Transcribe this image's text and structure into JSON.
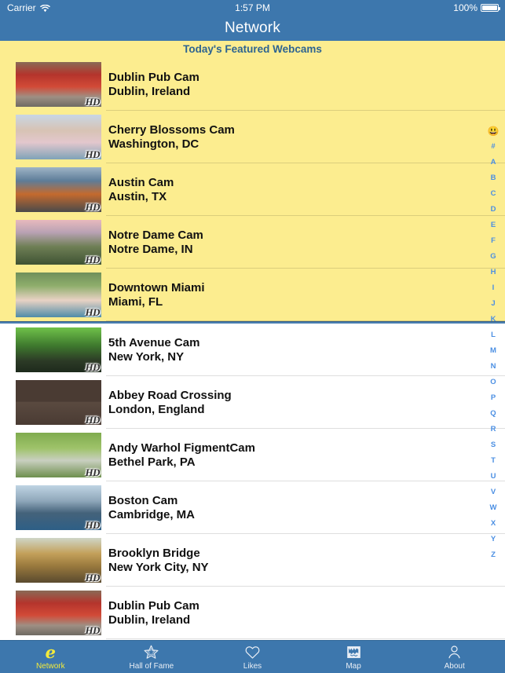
{
  "status_bar": {
    "carrier": "Carrier",
    "wifi_icon": "wifi-icon",
    "time": "1:57 PM",
    "battery_percent": "100%",
    "battery_icon": "battery-full-icon"
  },
  "nav": {
    "title": "Network"
  },
  "featured": {
    "header": "Today's Featured Webcams",
    "items": [
      {
        "name": "Dublin Pub Cam",
        "location": "Dublin, Ireland",
        "badge": "HD"
      },
      {
        "name": "Cherry Blossoms Cam",
        "location": "Washington, DC",
        "badge": "HD"
      },
      {
        "name": "Austin Cam",
        "location": "Austin, TX",
        "badge": "HD"
      },
      {
        "name": "Notre Dame Cam",
        "location": "Notre Dame, IN",
        "badge": "HD"
      },
      {
        "name": "Downtown Miami",
        "location": "Miami, FL",
        "badge": "HD"
      }
    ]
  },
  "main_list": {
    "items": [
      {
        "name": "5th Avenue Cam",
        "location": "New York, NY",
        "badge": "HD"
      },
      {
        "name": "Abbey Road Crossing",
        "location": "London, England",
        "badge": "HD"
      },
      {
        "name": "Andy Warhol FigmentCam",
        "location": "Bethel Park, PA",
        "badge": "HD"
      },
      {
        "name": "Boston Cam",
        "location": "Cambridge, MA",
        "badge": "HD"
      },
      {
        "name": "Brooklyn Bridge",
        "location": "New York City, NY",
        "badge": "HD"
      },
      {
        "name": "Dublin Pub Cam",
        "location": "Dublin, Ireland",
        "badge": "HD"
      }
    ]
  },
  "index_strip": {
    "items": [
      "😃",
      "#",
      "A",
      "B",
      "C",
      "D",
      "E",
      "F",
      "G",
      "H",
      "I",
      "J",
      "K",
      "L",
      "M",
      "N",
      "O",
      "P",
      "Q",
      "R",
      "S",
      "T",
      "U",
      "V",
      "W",
      "X",
      "Y",
      "Z"
    ]
  },
  "tabbar": {
    "tabs": [
      {
        "label": "Network",
        "icon": "network-e-logo-icon",
        "active": true
      },
      {
        "label": "Hall of Fame",
        "icon": "star-icon",
        "active": false
      },
      {
        "label": "Likes",
        "icon": "heart-icon",
        "active": false
      },
      {
        "label": "Map",
        "icon": "map-globe-icon",
        "active": false
      },
      {
        "label": "About",
        "icon": "person-icon",
        "active": false
      }
    ]
  },
  "colors": {
    "nav_blue": "#3d77ad",
    "featured_yellow": "#fced8f",
    "header_text": "#2e6490",
    "index_blue": "#4b8fe3",
    "active_tab": "#f2ea3c",
    "divider_blue": "#4a7fb0"
  }
}
